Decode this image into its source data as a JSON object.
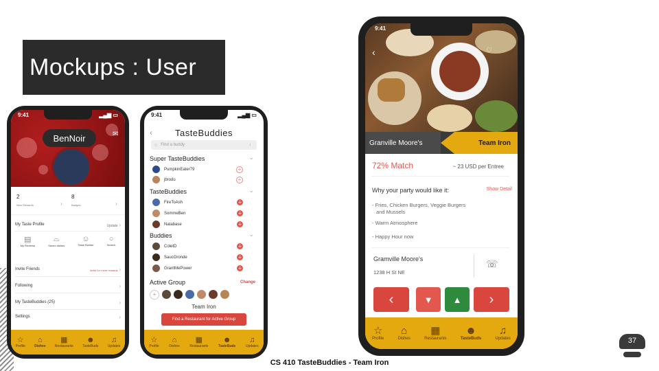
{
  "slide": {
    "title": "Mockups : User",
    "footer": "CS 410 TasteBuddies - Team Iron",
    "page_number": "37"
  },
  "status_time": "9:41",
  "tabs": [
    "Profile",
    "Dishes",
    "Restaurants",
    "TasteBuds",
    "Updates"
  ],
  "phone1": {
    "username": "BenNoir",
    "stats": [
      {
        "value": "2",
        "label": "New Rewards"
      },
      {
        "value": "8",
        "label": "Badges"
      }
    ],
    "taste_profile": {
      "label": "My Taste Profile",
      "action": "Update"
    },
    "quick": [
      "My Reviews",
      "Saved dishes",
      "Taste Builder",
      "Search"
    ],
    "menu": [
      {
        "label": "Invite Friends",
        "note": "Invite for more rewards"
      },
      {
        "label": "Following",
        "note": ""
      },
      {
        "label": "My TasteBuddies",
        "count": "(25)"
      },
      {
        "label": "Settings",
        "note": ""
      }
    ]
  },
  "phone2": {
    "title": "TasteBuddies",
    "search_placeholder": "Find a buddy",
    "super_title": "Super TasteBuddies",
    "super": [
      "PumpkinEater79",
      "jbrodu"
    ],
    "tb_title": "TasteBuddies",
    "tb": [
      "FireToAsh",
      "SommeBen",
      "Natabase"
    ],
    "buddies_title": "Buddies",
    "buddies": [
      "ColetD",
      "SaucOronde",
      "GrantMePower"
    ],
    "active_group": "Active Group",
    "change": "Change",
    "team": "Team Iron",
    "cta": "Find a Restaurant for Active Group"
  },
  "phone3": {
    "restaurant": "Granville Moore's",
    "team": "Team Iron",
    "match": "72% Match",
    "price": "~ 23 USD per Entree",
    "why": "Why your party would like it:",
    "show_detail": "Show Detail",
    "reasons": [
      "- Fries, Chicken Burgers, Veggie Burgers",
      "and Mussels",
      "- Warm Atmosphere",
      "- Happy Hour now"
    ],
    "name": "Gramville Moore's",
    "address": "1238 H St NE"
  },
  "colors": {
    "accent": "#e4a90e",
    "red": "#d9463d",
    "green": "#2e8b3e",
    "dark": "#2b2b2b"
  }
}
